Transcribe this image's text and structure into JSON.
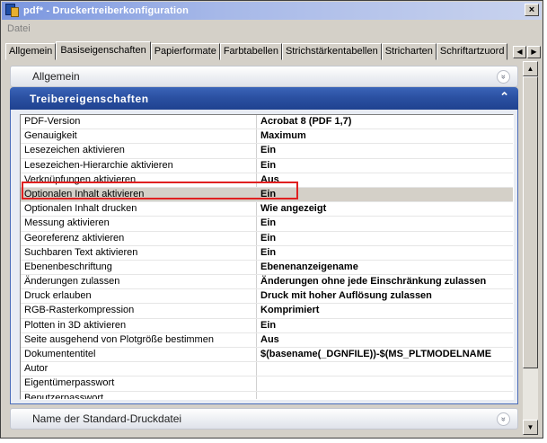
{
  "window": {
    "title": "pdf* - Druckertreiberkonfiguration",
    "close_label": "×"
  },
  "menu": {
    "file": "Datei"
  },
  "tabs": [
    {
      "label": "Allgemein",
      "active": false
    },
    {
      "label": "Basiseigenschaften",
      "active": true
    },
    {
      "label": "Papierformate",
      "active": false
    },
    {
      "label": "Farbtabellen",
      "active": false
    },
    {
      "label": "Strichstärkentabellen",
      "active": false
    },
    {
      "label": "Stricharten",
      "active": false
    },
    {
      "label": "Schriftartzuord",
      "active": false
    }
  ],
  "tab_scroll": {
    "left": "◀",
    "right": "▶"
  },
  "panels": {
    "general": {
      "label": "Allgemein",
      "chevron": "»"
    },
    "driver_properties": {
      "label": "Treibereigenschaften",
      "chevron": "⌃"
    },
    "default_print_file": {
      "label": "Name der Standard-Druckdatei",
      "chevron": "»"
    }
  },
  "properties": [
    {
      "name": "PDF-Version",
      "value": "Acrobat 8 (PDF 1,7)"
    },
    {
      "name": "Genauigkeit",
      "value": "Maximum"
    },
    {
      "name": "Lesezeichen aktivieren",
      "value": "Ein"
    },
    {
      "name": "Lesezeichen-Hierarchie aktivieren",
      "value": "Ein"
    },
    {
      "name": "Verknüpfungen aktivieren",
      "value": "Aus"
    },
    {
      "name": "Optionalen Inhalt aktivieren",
      "value": "Ein"
    },
    {
      "name": "Optionalen Inhalt drucken",
      "value": "Wie angezeigt"
    },
    {
      "name": "Messung aktivieren",
      "value": "Ein"
    },
    {
      "name": "Georeferenz aktivieren",
      "value": "Ein"
    },
    {
      "name": "Suchbaren Text aktivieren",
      "value": "Ein"
    },
    {
      "name": "Ebenenbeschriftung",
      "value": "Ebenenanzeigename"
    },
    {
      "name": "Änderungen zulassen",
      "value": "Änderungen ohne jede Einschränkung zulassen"
    },
    {
      "name": "Druck erlauben",
      "value": "Druck mit hoher Auflösung zulassen"
    },
    {
      "name": "RGB-Rasterkompression",
      "value": "Komprimiert"
    },
    {
      "name": "Plotten in 3D aktivieren",
      "value": "Ein"
    },
    {
      "name": "Seite ausgehend von Plotgröße bestimmen",
      "value": "Aus"
    },
    {
      "name": "Dokumententitel",
      "value": "$(basename(_DGNFILE))-$(MS_PLTMODELNAME"
    },
    {
      "name": "Autor",
      "value": ""
    },
    {
      "name": "Eigentümerpasswort",
      "value": ""
    },
    {
      "name": "Benutzerpasswort",
      "value": ""
    }
  ],
  "selected_property_index": 5,
  "scrollbar": {
    "up": "▲",
    "down": "▼"
  },
  "colors": {
    "section_header": "#2a4fa0",
    "highlight_border": "#e02020",
    "window_bg": "#d4d0c8"
  }
}
